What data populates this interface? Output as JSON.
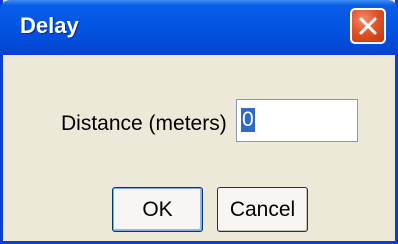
{
  "window": {
    "title": "Delay",
    "close_icon": "close-icon"
  },
  "form": {
    "distance_label": "Distance (meters)",
    "distance_value": "0"
  },
  "buttons": {
    "ok_label": "OK",
    "cancel_label": "Cancel"
  },
  "colors": {
    "titlebar": "#0355e3",
    "dialog_background": "#ece9d8",
    "close_button": "#e0542b",
    "selection": "#316ac5"
  }
}
